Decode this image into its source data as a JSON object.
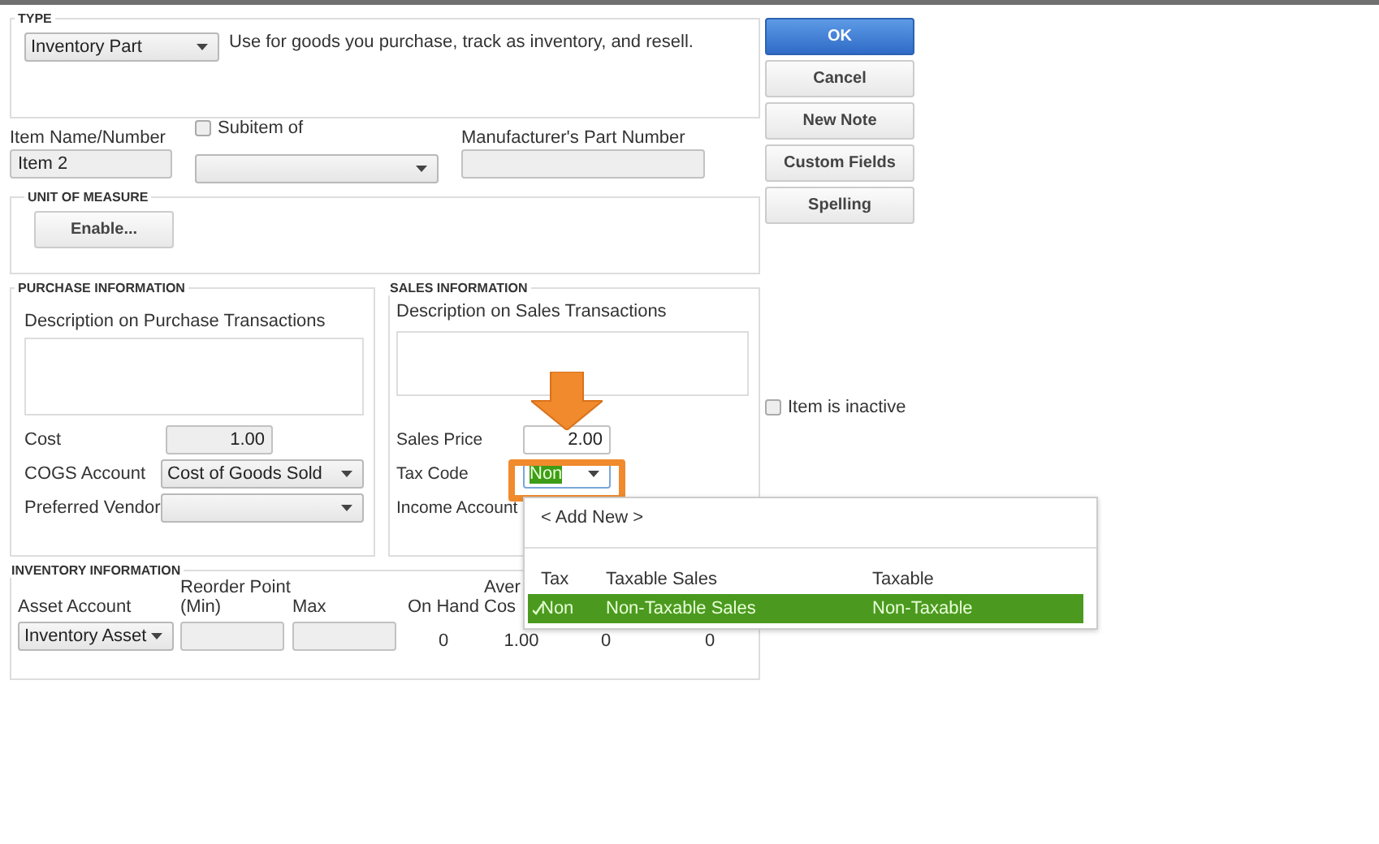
{
  "type_section": {
    "heading": "TYPE",
    "type_value": "Inventory Part",
    "description": "Use for goods you purchase, track as inventory, and resell."
  },
  "item": {
    "name_label": "Item Name/Number",
    "name_value": "Item 2",
    "subitem_label": "Subitem of",
    "subitem_checked": false,
    "manufacturer_label": "Manufacturer's Part Number"
  },
  "unit_of_measure": {
    "heading": "UNIT OF MEASURE",
    "button": "Enable..."
  },
  "purchase": {
    "heading": "PURCHASE INFORMATION",
    "description_label": "Description on Purchase Transactions",
    "cost_label": "Cost",
    "cost_value": "1.00",
    "cogs_label": "COGS Account",
    "cogs_value": "Cost of Goods Sold",
    "vendor_label": "Preferred Vendor"
  },
  "sales": {
    "heading": "SALES INFORMATION",
    "description_label": "Description on Sales Transactions",
    "price_label": "Sales Price",
    "price_value": "2.00",
    "tax_label": "Tax Code",
    "tax_value": "Non",
    "income_label": "Income Account"
  },
  "inventory": {
    "heading": "INVENTORY INFORMATION",
    "asset_label": "Asset Account",
    "reorder_label": "Reorder Point (Min)",
    "max_label": "Max",
    "on_hand_label": "On Hand",
    "column_5_label": "Aver Cos",
    "asset_value": "Inventory Asset",
    "on_hand_value": "0",
    "column_5_value": "1.00",
    "column_6_value": "0",
    "column_7_value": "0"
  },
  "buttons": [
    {
      "label": "OK",
      "kind": "primary"
    },
    {
      "label": "Cancel",
      "kind": "normal"
    },
    {
      "label": "New Note",
      "kind": "normal"
    },
    {
      "label": "Custom Fields",
      "kind": "normal"
    },
    {
      "label": "Spelling",
      "kind": "normal"
    }
  ],
  "inactive": {
    "label": "Item is inactive",
    "checked": false
  },
  "tax_dropdown": {
    "add_new": "< Add New >",
    "columns": [
      "Tax",
      "Taxable Sales",
      "Taxable"
    ],
    "rows": [
      {
        "cells": [
          "Non",
          "Non-Taxable Sales",
          "Non-Taxable"
        ],
        "selected": true
      }
    ]
  }
}
